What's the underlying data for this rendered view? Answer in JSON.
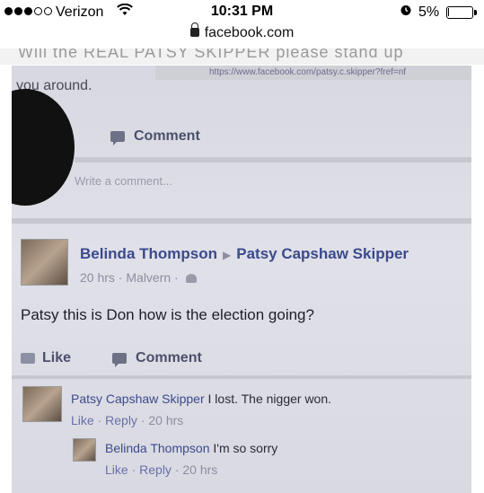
{
  "status_bar": {
    "carrier": "Verizon",
    "time": "10:31 PM",
    "battery_percent": "5%",
    "battery_level": 0.05,
    "icons": [
      "signal-dots",
      "wifi-icon",
      "alarm-icon",
      "battery-icon"
    ]
  },
  "address_bar": {
    "url": "facebook.com",
    "icon": "lock-icon"
  },
  "page": {
    "partial_top_text": "Will the REAL PATSY SKIPPER please stand up"
  },
  "photo": {
    "browser_url": "https://www.facebook.com/patsy.c.skipper?fref=nf",
    "partial_text": "you around.",
    "action_bar_1": {
      "comment": "Comment"
    },
    "write_comment_placeholder": "Write a comment...",
    "post": {
      "author": "Belinda Thompson",
      "target": "Patsy Capshaw Skipper",
      "time": "20 hrs",
      "location": "Malvern",
      "body": "Patsy this is Don how is the election going?",
      "like": "Like",
      "comment": "Comment"
    },
    "comments": [
      {
        "author": "Patsy Capshaw Skipper",
        "text": "I lost. The nigger won.",
        "like": "Like",
        "reply": "Reply",
        "time": "20 hrs"
      }
    ],
    "replies": [
      {
        "author": "Belinda Thompson",
        "text": "I'm so sorry",
        "like": "Like",
        "reply": "Reply",
        "time": "20 hrs"
      }
    ]
  },
  "colors": {
    "facebook_blue": "#3b4a8c",
    "meta_gray": "#8d8da0",
    "screen_bg": "#dcdce4"
  }
}
